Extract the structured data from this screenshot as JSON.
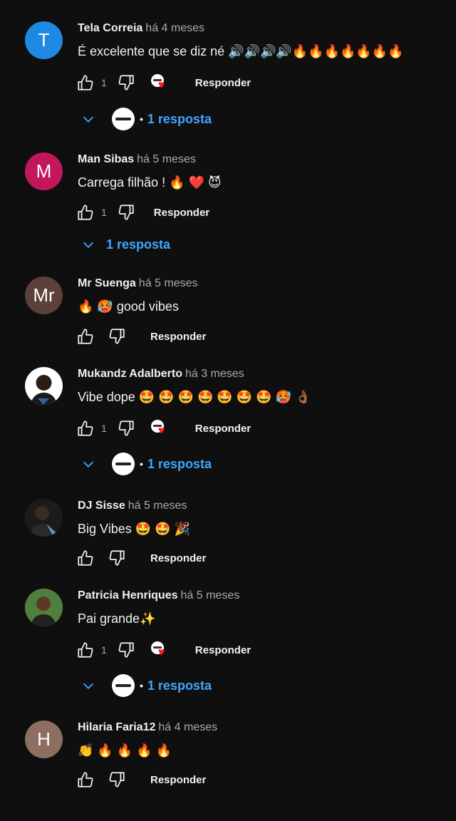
{
  "labels": {
    "reply": "Responder"
  },
  "colors": {
    "link": "#3ea6ff",
    "time": "#aaaaaa"
  },
  "comments": [
    {
      "author": "Tela Correia",
      "time": "há 4 meses",
      "text": "É excelente que se diz né 🔊🔊🔊🔊🔥🔥🔥🔥🔥🔥🔥",
      "avatar_letter": "T",
      "avatar_color": "#1e88e5",
      "likes": "1",
      "creator_heart": true,
      "replies_label": "1 resposta"
    },
    {
      "author": "Man Sibas",
      "time": "há 5 meses",
      "text": "Carrega filhão ! 🔥 ❤️ 😈",
      "avatar_letter": "M",
      "avatar_color": "#c2185b",
      "likes": "1",
      "creator_heart": false,
      "replies_label": "1 resposta"
    },
    {
      "author": "Mr Suenga",
      "time": "há 5 meses",
      "text": "🔥 🥵 good vibes",
      "avatar_letter": "Mr",
      "avatar_color": "#5d4037",
      "likes": "",
      "creator_heart": false,
      "replies_label": ""
    },
    {
      "author": "Mukandz Adalberto",
      "time": "há 3 meses",
      "text": "Vibe dope 🤩 🤩 🤩 🤩 🤩 🤩 🤩 🥵 👌🏾",
      "avatar_letter": "",
      "avatar_color": "#ffffff",
      "likes": "1",
      "creator_heart": true,
      "replies_label": "1 resposta"
    },
    {
      "author": "DJ Sisse",
      "time": "há 5 meses",
      "text": "Big Vibes 🤩 🤩 🎉",
      "avatar_letter": "",
      "avatar_color": "#1b1b1b",
      "likes": "",
      "creator_heart": false,
      "replies_label": ""
    },
    {
      "author": "Patricia Henriques",
      "time": "há 5 meses",
      "text": "Pai grande✨",
      "avatar_letter": "",
      "avatar_color": "#3c6e3a",
      "likes": "1",
      "creator_heart": true,
      "replies_label": "1 resposta"
    },
    {
      "author": "Hilaria Faria12",
      "time": "há 4 meses",
      "text": "👏 🔥 🔥 🔥 🔥",
      "avatar_letter": "H",
      "avatar_color": "#8d6e63",
      "likes": "",
      "creator_heart": false,
      "replies_label": ""
    }
  ]
}
